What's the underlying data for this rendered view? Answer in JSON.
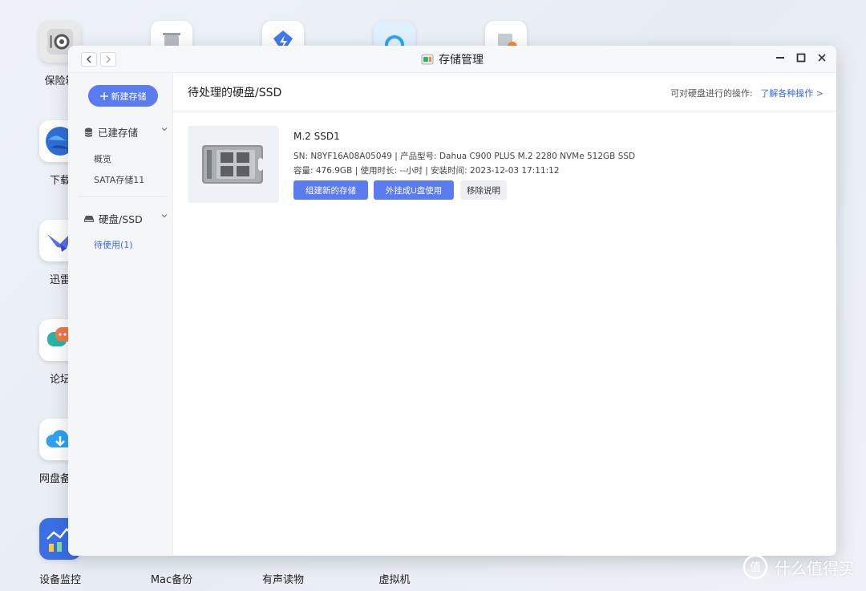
{
  "desktop": {
    "icons": [
      {
        "label": "保险箱"
      },
      {
        "label": "下载"
      },
      {
        "label": "迅雷"
      },
      {
        "label": "论坛"
      },
      {
        "label": "网盘备份"
      },
      {
        "label": "设备监控"
      },
      {
        "label": "Mac备份"
      },
      {
        "label": "有声读物"
      },
      {
        "label": "虚拟机"
      }
    ]
  },
  "window": {
    "title": "存储管理",
    "app_icon": "storage-manager-icon"
  },
  "sidebar": {
    "new_storage_label": "新建存储",
    "sections": [
      {
        "label": "已建存储",
        "items": [
          {
            "label": "概览",
            "active": false
          },
          {
            "label": "SATA存储11",
            "active": false
          }
        ]
      },
      {
        "label": "硬盘/SSD",
        "items": [
          {
            "label": "待使用(1)",
            "active": true
          }
        ]
      }
    ]
  },
  "main": {
    "title": "待处理的硬盘/SSD",
    "hint": "可对硬盘进行的操作:",
    "hint_link": "了解各种操作 >",
    "disk": {
      "name": "M.2   SSD1",
      "sn_line": "SN:  N8YF16A08A05049 | 产品型号:  Dahua C900 PLUS M.2 2280 NVMe 512GB SSD",
      "capacity_line": "容量:  476.9GB | 使用时长:  --小时 | 安装时间:  2023-12-03 17:11:12",
      "actions": {
        "create": "组建新的存储",
        "usb": "外挂成U盘使用",
        "remove": "移除说明"
      }
    }
  },
  "watermark": {
    "text": "什么值得买",
    "logo_char": "值"
  },
  "colors": {
    "accent": "#5b7cf0",
    "link": "#3a67e6"
  }
}
